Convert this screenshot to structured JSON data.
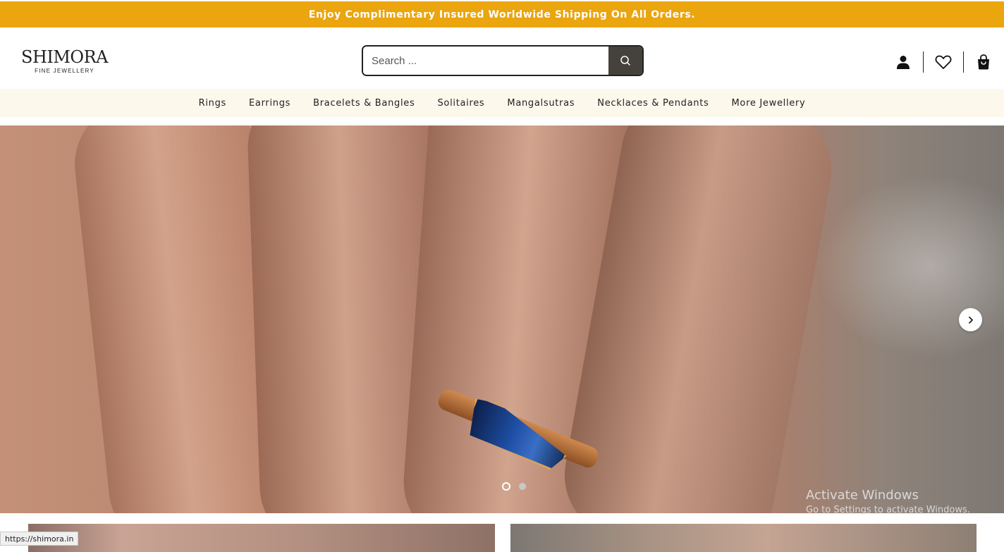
{
  "announcement": {
    "text": "Enjoy Complimentary Insured Worldwide Shipping On All Orders."
  },
  "logo": {
    "brand": "SHIMORA",
    "tagline": "FINE JEWELLERY"
  },
  "search": {
    "placeholder": "Search ...",
    "value": "",
    "button_icon": "search-icon"
  },
  "header_icons": [
    "user-icon",
    "heart-icon",
    "bag-icon"
  ],
  "nav": {
    "items": [
      {
        "label": "Rings"
      },
      {
        "label": "Earrings"
      },
      {
        "label": "Bracelets & Bangles"
      },
      {
        "label": "Solitaires"
      },
      {
        "label": "Mangalsutras"
      },
      {
        "label": "Necklaces & Pendants"
      },
      {
        "label": "More Jewellery"
      }
    ]
  },
  "hero": {
    "slide_count": 2,
    "active_slide": 1,
    "next_icon": "chevron-right-icon"
  },
  "watermark": {
    "title": "Activate Windows",
    "subtitle": "Go to Settings to activate Windows."
  },
  "status_bar": {
    "url": "https://shimora.in"
  },
  "colors": {
    "announcement_bg": "#eaa50f",
    "nav_bg": "#fdf8ec",
    "search_button_bg": "#45413b"
  }
}
